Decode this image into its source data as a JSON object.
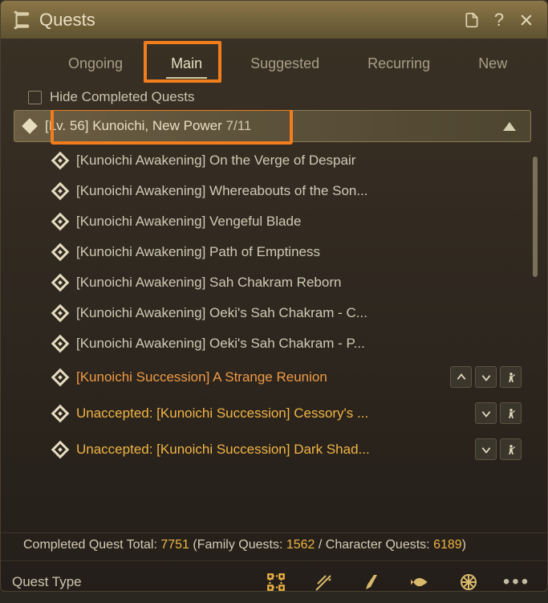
{
  "title": "Quests",
  "tabs": [
    "Ongoing",
    "Main",
    "Suggested",
    "Recurring",
    "New"
  ],
  "activeTab": 1,
  "filter": {
    "hideCompleted": "Hide Completed Quests"
  },
  "group": {
    "title": "[Lv. 56] Kunoichi, New Power",
    "done": "7",
    "total": "/11"
  },
  "quests": [
    {
      "text": "[Kunoichi Awakening] On the Verge of Despair",
      "style": "",
      "actions": []
    },
    {
      "text": "[Kunoichi Awakening] Whereabouts of the Son...",
      "style": "",
      "actions": []
    },
    {
      "text": "[Kunoichi Awakening] Vengeful Blade",
      "style": "",
      "actions": []
    },
    {
      "text": "[Kunoichi Awakening] Path of Emptiness",
      "style": "",
      "actions": []
    },
    {
      "text": "[Kunoichi Awakening] Sah Chakram Reborn",
      "style": "",
      "actions": []
    },
    {
      "text": "[Kunoichi Awakening] Oeki's Sah Chakram - C...",
      "style": "",
      "actions": []
    },
    {
      "text": "[Kunoichi Awakening] Oeki's Sah Chakram - P...",
      "style": "",
      "actions": []
    },
    {
      "text": "[Kunoichi Succession] A Strange Reunion",
      "style": "active",
      "actions": [
        "up",
        "down",
        "nav"
      ]
    },
    {
      "text": "Unaccepted: [Kunoichi Succession] Cessory's ...",
      "style": "unaccepted",
      "actions": [
        "down",
        "nav"
      ]
    },
    {
      "text": "Unaccepted: [Kunoichi Succession] Dark Shad...",
      "style": "unaccepted",
      "actions": [
        "down",
        "nav"
      ]
    }
  ],
  "summary": {
    "prefix": "Completed Quest Total: ",
    "total": "7751",
    "mid1": " (Family Quests: ",
    "family": "1562",
    "mid2": " / Character Quests: ",
    "char": "6189",
    "suffix": ")"
  },
  "footer": {
    "label": "Quest Type"
  }
}
